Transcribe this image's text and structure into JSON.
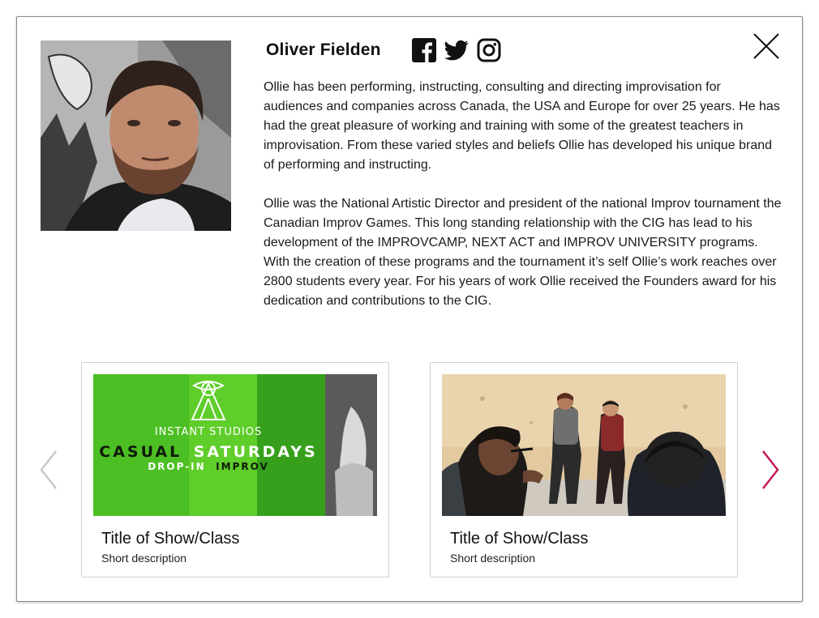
{
  "profile": {
    "name": "Oliver Fielden",
    "photo_alt": "Oliver Fielden portrait",
    "bio": [
      "Ollie has been performing, instructing, consulting and directing improvisation for audiences and companies across Canada, the USA and Europe for over 25 years. He has had the great pleasure of working and training with some of the greatest teachers in improvisation. From these varied styles and beliefs Ollie has developed his unique brand of performing and instructing.",
      "Ollie was the National Artistic Director and president of the national Improv tournament the Canadian Improv Games. This long standing relationship with the CIG has lead to his development of the IMPROVCAMP, NEXT ACT and IMPROV UNIVERSITY programs. With the creation of these programs and the tournament it’s self Ollie’s work reaches over 2800 students every year. For his years of work Ollie received the Founders award for his dedication and contributions to the CIG."
    ]
  },
  "socials": [
    {
      "name": "facebook",
      "icon": "facebook-icon"
    },
    {
      "name": "twitter",
      "icon": "twitter-icon"
    },
    {
      "name": "instagram",
      "icon": "instagram-icon"
    }
  ],
  "close": {
    "icon": "close-icon"
  },
  "carousel": {
    "prev_icon": "chevron-left-icon",
    "next_icon": "chevron-right-icon",
    "prev_color": "#c8c8c8",
    "next_color": "#c2185b",
    "cards": [
      {
        "title": "Title of Show/Class",
        "description": "Short description",
        "image": {
          "line1": "INSTANT STUDIOS",
          "line2a": "CASUAL",
          "line2b": "SATURDAYS",
          "line3a": "DROP-IN",
          "line3b": "IMPROV"
        }
      },
      {
        "title": "Title of Show/Class",
        "description": "Short description"
      }
    ]
  },
  "colors": {
    "brand_green": "#5ec72a",
    "dark_green": "#2e8f1c"
  }
}
